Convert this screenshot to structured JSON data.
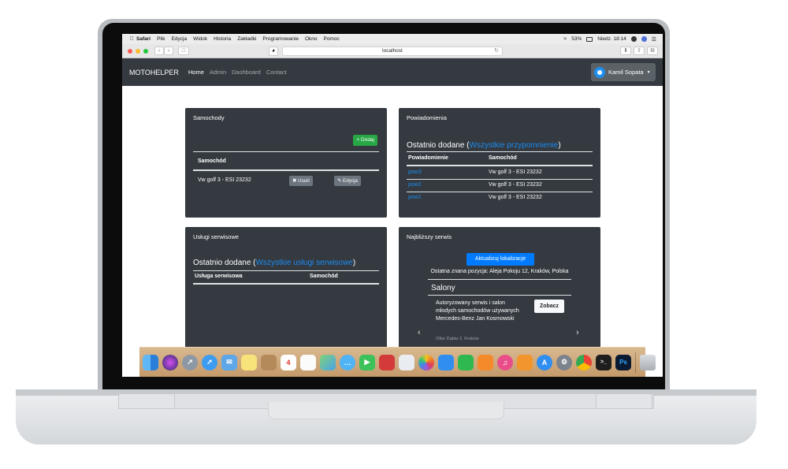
{
  "menubar": {
    "apple": "",
    "items": [
      "Safari",
      "Plik",
      "Edycja",
      "Widok",
      "Historia",
      "Zakładki",
      "Programowanie",
      "Okno",
      "Pomoc"
    ],
    "battery": "53%",
    "clock": "Niedz. 18:14"
  },
  "browser": {
    "url": "localhost"
  },
  "navbar": {
    "brand": "MOTOHELPER",
    "links": [
      "Home",
      "Admin",
      "Dashboard",
      "Contact"
    ],
    "user": "Kamil Sopata"
  },
  "cars": {
    "title": "Samochody",
    "add_label": "+ Dodaj",
    "col_header": "Samochód",
    "rows": [
      {
        "car": "Vw golf 3 - ESI 23232",
        "delete_label": "✖ Usuń",
        "edit_label": "✎ Edycja"
      }
    ]
  },
  "notifications": {
    "title": "Powiadomienia",
    "heading_prefix": "Ostatnio dodane (",
    "heading_link": "Wszystkie przypomnienie",
    "heading_suffix": ")",
    "col_notif": "Powiadomienie",
    "col_car": "Samochód",
    "rows": [
      {
        "notif": "pow3",
        "car": "Vw golf 3 - ESI 23232"
      },
      {
        "notif": "pow2",
        "car": "Vw golf 3 - ESI 23232"
      },
      {
        "notif": "pow1",
        "car": "Vw golf 3 - ESI 23232"
      }
    ]
  },
  "services": {
    "title": "Usługi serwisowe",
    "heading_prefix": "Ostatnio dodane (",
    "heading_link": "Wszystkie usługi serwisowe",
    "heading_suffix": ")",
    "col_service": "Usługa serwisowa",
    "col_car": "Samochód"
  },
  "nearest": {
    "title": "Najbliższy serwis",
    "update_label": "Aktualizuj lokalizacje",
    "location": "Ostatna znana pozycja: Aleja Pokoju 12, Kraków, Polska",
    "salony_title": "Salony",
    "salon_name": "Autoryzowany serwis i salon młodych samochodów używanych Mercedes-Benz Jan Kosmowski",
    "salon_addr": "Ofiar Dąbia 2, Kraków",
    "view_label": "Zobacz",
    "prev": "‹",
    "next": "›"
  },
  "dock": {
    "calendar_day": "4"
  }
}
